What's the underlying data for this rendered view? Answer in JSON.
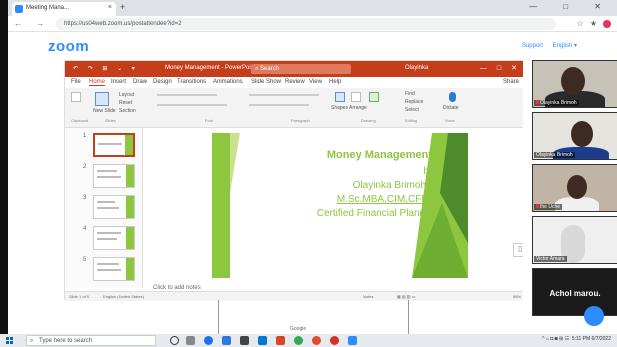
{
  "browser": {
    "tab_title": "Meeting Mana...",
    "tab_close": "×",
    "new_tab": "+",
    "window_controls": "—  □  ✕",
    "url": "https://us04web.zoom.us/postattendee?id=2",
    "nav": "← → C"
  },
  "zoom": {
    "logo": "zoom",
    "support": "Support",
    "language": "English ▾"
  },
  "powerpoint": {
    "quick_access": "↶ ↷ ⊞ ⌄ ▾",
    "doc_title": "Money Management - PowerPoint",
    "search": "Search",
    "user": "Olayinka",
    "menu": [
      "File",
      "Home",
      "Insert",
      "Draw",
      "Design",
      "Transitions",
      "Animations",
      "Slide Show",
      "Review",
      "View",
      "Help"
    ],
    "active_menu": "Home",
    "share": "Share",
    "ribbon_groups": [
      "Clipboard",
      "Slides",
      "Font",
      "Paragraph",
      "Drawing",
      "Editing",
      "Voice"
    ],
    "new_slide": "New Slide",
    "layout": "Layout",
    "reset": "Reset",
    "section": "Section",
    "shapes": "Shapes",
    "arrange": "Arrange",
    "quick_styles": "Quick Styles",
    "find": "Find",
    "replace": "Replace",
    "select": "Select",
    "dictate": "Dictate",
    "notes_placeholder": "Click to add notes",
    "status_left": "Slide 1 of 5",
    "status_lang": "English (United States)",
    "status_notes": "Notes",
    "zoom_pct": "58%"
  },
  "slide": {
    "title": "Money Management",
    "by": "by",
    "author": "Olayinka Brimoh",
    "credentials": "M.Sc,MBA,CIM,CFP",
    "role": "Certified Financial Planner"
  },
  "thumbnails": [
    "1",
    "2",
    "3",
    "4",
    "5"
  ],
  "participants": [
    {
      "name": "Olayinka Brimoh"
    },
    {
      "name": "Olayinka Brimoh"
    },
    {
      "name": "Ihe Uche"
    },
    {
      "name": "Victor Amara"
    },
    {
      "name": "Achol marou."
    }
  ],
  "taskbar": {
    "search_placeholder": "Type here to search",
    "time": "5:11 PM",
    "date": "6/7/2022"
  },
  "page_footer": "Google"
}
